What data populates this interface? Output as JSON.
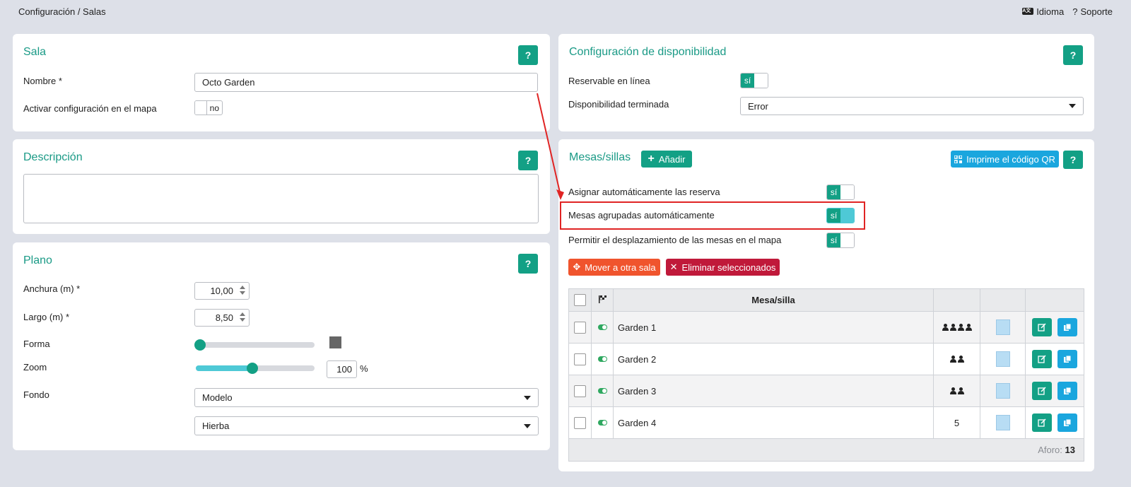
{
  "breadcrumb": "Configuración / Salas",
  "topbar": {
    "idioma": "Idioma",
    "soporte": "Soporte",
    "help_glyph": "?"
  },
  "sala": {
    "title": "Sala",
    "help": "?",
    "nombre_label": "Nombre *",
    "nombre_value": "Octo Garden",
    "mapa_label": "Activar configuración en el mapa",
    "mapa_toggle": "no"
  },
  "descripcion": {
    "title": "Descripción",
    "help": "?"
  },
  "plano": {
    "title": "Plano",
    "help": "?",
    "anchura_label": "Anchura (m) *",
    "anchura_value": "10,00",
    "largo_label": "Largo (m) *",
    "largo_value": "8,50",
    "forma_label": "Forma",
    "forma_level": 0,
    "zoom_label": "Zoom",
    "zoom_value": "100",
    "zoom_unit": "%",
    "zoom_level": 0.45,
    "fondo_label": "Fondo",
    "fondo_tipo": "Modelo",
    "fondo_valor": "Hierba"
  },
  "disponibilidad": {
    "title": "Configuración de disponibilidad",
    "help": "?",
    "reservable_label": "Reservable en línea",
    "reservable_toggle": "sí",
    "terminada_label": "Disponibilidad terminada",
    "terminada_value": "Error"
  },
  "mesas": {
    "title": "Mesas/sillas",
    "add_label": "Añadir",
    "qr_label": "Imprime el código QR",
    "help": "?",
    "asignar_label": "Asignar automáticamente las reserva",
    "asignar_toggle": "sí",
    "agrupadas_label": "Mesas agrupadas automáticamente",
    "agrupadas_toggle": "sí",
    "desplazamiento_label": "Permitir el desplazamiento de las mesas en el mapa",
    "desplazamiento_toggle": "sí",
    "mover_label": "Mover a otra sala",
    "eliminar_label": "Eliminar seleccionados",
    "col_mesa": "Mesa/silla",
    "rows": [
      {
        "name": "Garden 1",
        "capacity_icons": 4,
        "capacity_text": ""
      },
      {
        "name": "Garden 2",
        "capacity_icons": 2,
        "capacity_text": ""
      },
      {
        "name": "Garden 3",
        "capacity_icons": 2,
        "capacity_text": ""
      },
      {
        "name": "Garden 4",
        "capacity_icons": 0,
        "capacity_text": "5"
      }
    ],
    "aforo_label": "Aforo:",
    "aforo_value": "13"
  },
  "colors": {
    "accent": "#13a085",
    "title": "#1a9a86",
    "qr": "#1aa6de",
    "mover": "#f0542d",
    "eliminar": "#c0193a",
    "highlight": "#e02424"
  }
}
